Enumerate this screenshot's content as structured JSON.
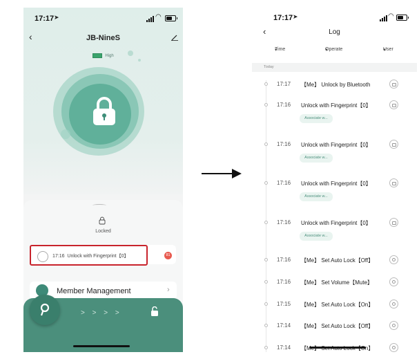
{
  "left": {
    "status_time": "17:17",
    "title": "JB-NineS",
    "battery_label": "High",
    "lock_status": "Locked",
    "notification": {
      "time": "17:16",
      "text": "Unlock with Fingerprint【0】",
      "badge": "81"
    },
    "member_label": "Member Management",
    "slide_arrows": "> > > >",
    "colors": {
      "accent": "#4b8f7c",
      "highlight": "#c8232c",
      "badge": "#e85a4f"
    }
  },
  "right": {
    "status_time": "17:17",
    "title": "Log",
    "filters": {
      "time": "Time",
      "operate": "Operate",
      "user": "User"
    },
    "section": "Today",
    "assoc_label": "Associate w...",
    "rows": [
      {
        "time": "17:17",
        "op": "【Me】 Unlock by Bluetooth",
        "icon": "unlock-icon",
        "assoc": false
      },
      {
        "time": "17:16",
        "op": "Unlock with Fingerprint【0】",
        "icon": "unlock-icon",
        "assoc": true
      },
      {
        "time": "17:16",
        "op": "Unlock with Fingerprint【0】",
        "icon": "unlock-icon",
        "assoc": true
      },
      {
        "time": "17:16",
        "op": "Unlock with Fingerprint【0】",
        "icon": "unlock-icon",
        "assoc": true
      },
      {
        "time": "17:16",
        "op": "Unlock with Fingerprint【0】",
        "icon": "unlock-icon",
        "assoc": true
      },
      {
        "time": "17:16",
        "op": "【Me】 Set Auto Lock【Off】",
        "icon": "settings-icon",
        "assoc": false
      },
      {
        "time": "17:16",
        "op": "【Me】 Set Volume【Mute】",
        "icon": "settings-icon",
        "assoc": false
      },
      {
        "time": "17:15",
        "op": "【Me】 Set Auto Lock【On】",
        "icon": "settings-icon",
        "assoc": false
      },
      {
        "time": "17:14",
        "op": "【Me】 Set Auto Lock【Off】",
        "icon": "settings-icon",
        "assoc": false
      },
      {
        "time": "17:14",
        "op": "【Me】 Set Auto Lock【On】",
        "icon": "settings-icon",
        "assoc": false
      }
    ]
  }
}
